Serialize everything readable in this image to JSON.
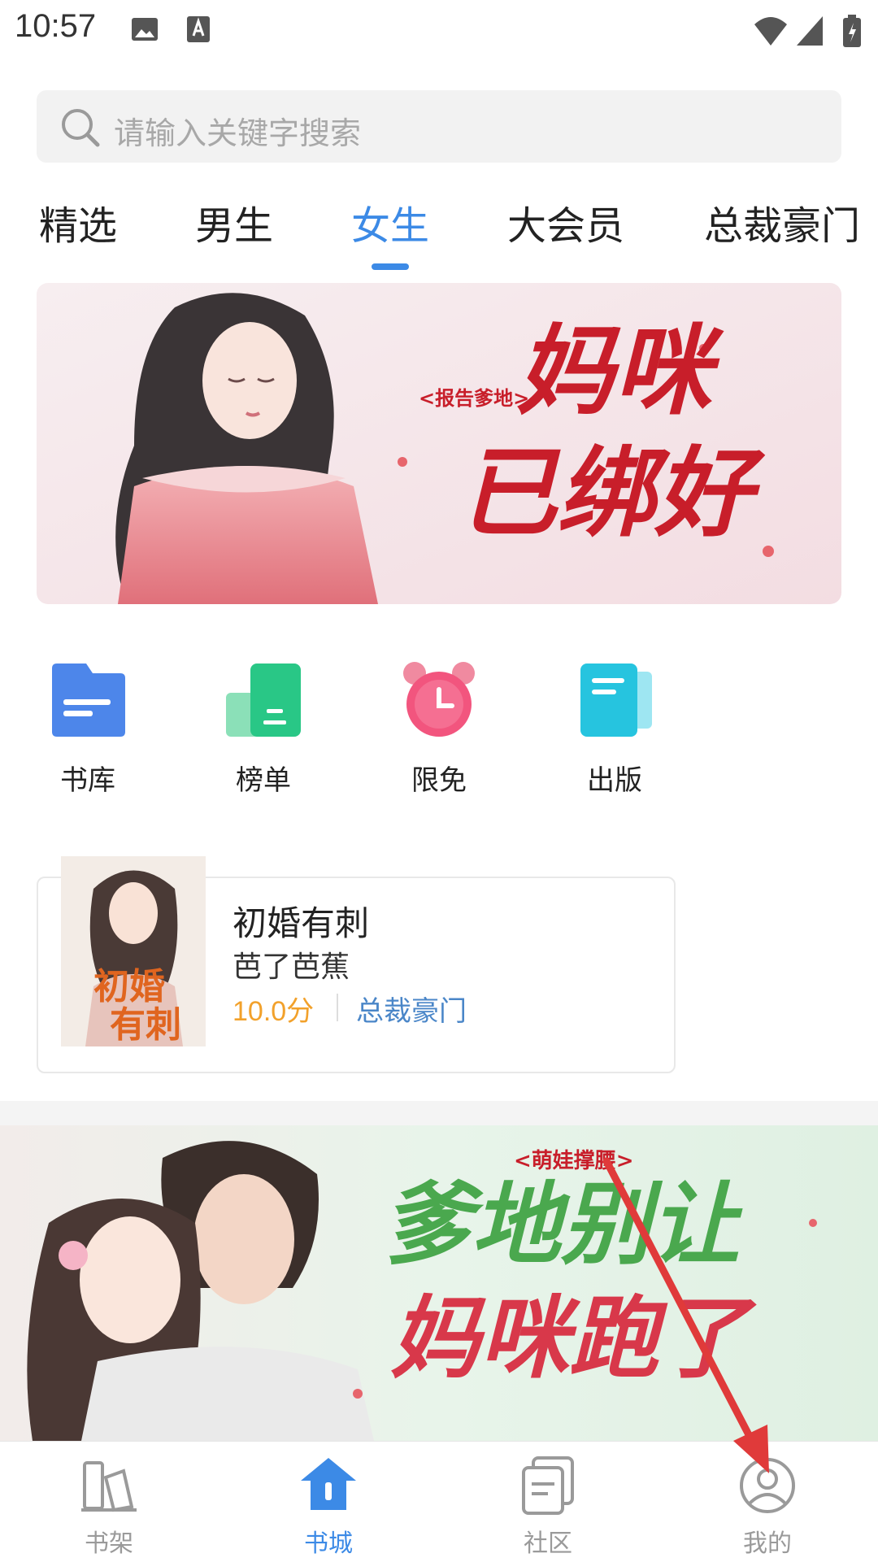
{
  "status_bar": {
    "time": "10:57"
  },
  "search": {
    "placeholder": "请输入关键字搜索"
  },
  "tabs": [
    {
      "label": "精选"
    },
    {
      "label": "男生"
    },
    {
      "label": "女生",
      "active": true
    },
    {
      "label": "大会员"
    },
    {
      "label": "总裁豪门"
    }
  ],
  "banner1": {
    "subtitle": "<报告爹地>",
    "title_line1": "妈咪",
    "title_line2": "已绑好"
  },
  "quick_entries": [
    {
      "label": "书库",
      "icon": "folder-icon"
    },
    {
      "label": "榜单",
      "icon": "ranking-icon"
    },
    {
      "label": "限免",
      "icon": "alarm-clock-icon"
    },
    {
      "label": "出版",
      "icon": "publish-book-icon"
    }
  ],
  "book": {
    "title": "初婚有刺",
    "author": "芭了芭蕉",
    "score": "10.0分",
    "genre": "总裁豪门",
    "cover_text_line1": "初婚",
    "cover_text_line2": "有刺"
  },
  "banner2": {
    "subtitle": "<萌娃撑腰>",
    "title_line1": "爹地别让",
    "title_line2": "妈咪跑了"
  },
  "bottom_nav": [
    {
      "label": "书架",
      "icon": "bookshelf-icon"
    },
    {
      "label": "书城",
      "icon": "bookstore-icon",
      "active": true
    },
    {
      "label": "社区",
      "icon": "community-icon"
    },
    {
      "label": "我的",
      "icon": "profile-icon"
    }
  ],
  "colors": {
    "accent": "#3c8ae6",
    "score": "#f2a12b",
    "genre": "#4a86c8",
    "banner_red": "#c81e2a",
    "annotation_arrow": "#e03a3a"
  }
}
